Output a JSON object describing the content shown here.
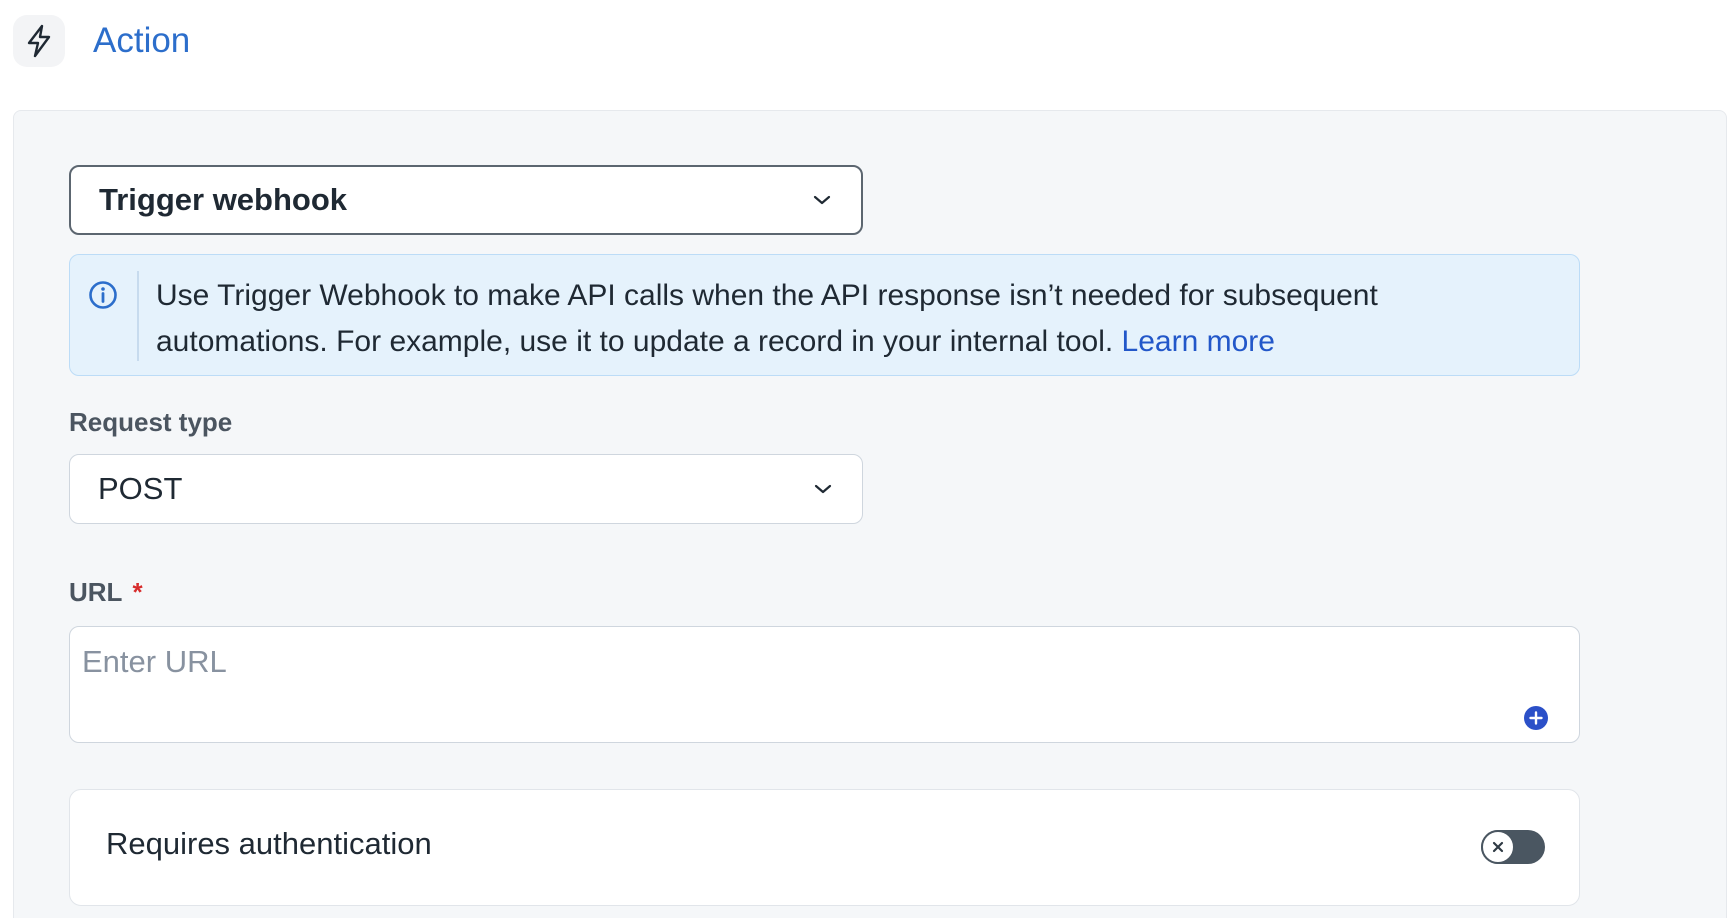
{
  "header": {
    "title": "Action",
    "icon": "lightning-bolt-icon",
    "title_color": "#2c6ecb"
  },
  "action_select": {
    "value": "Trigger webhook"
  },
  "info_banner": {
    "text": "Use Trigger Webhook to make API calls when the API response isn’t needed for subsequent automations. For example, use it to update a record in your internal tool.",
    "link_label": "Learn more",
    "icon": "info-icon"
  },
  "request_type": {
    "label": "Request type",
    "value": "POST"
  },
  "url_field": {
    "label": "URL",
    "required_mark": "*",
    "placeholder": "Enter URL",
    "value": "",
    "add_icon": "plus-circle-icon",
    "add_icon_color": "#2b50c8"
  },
  "auth": {
    "label": "Requires authentication",
    "enabled": false
  }
}
